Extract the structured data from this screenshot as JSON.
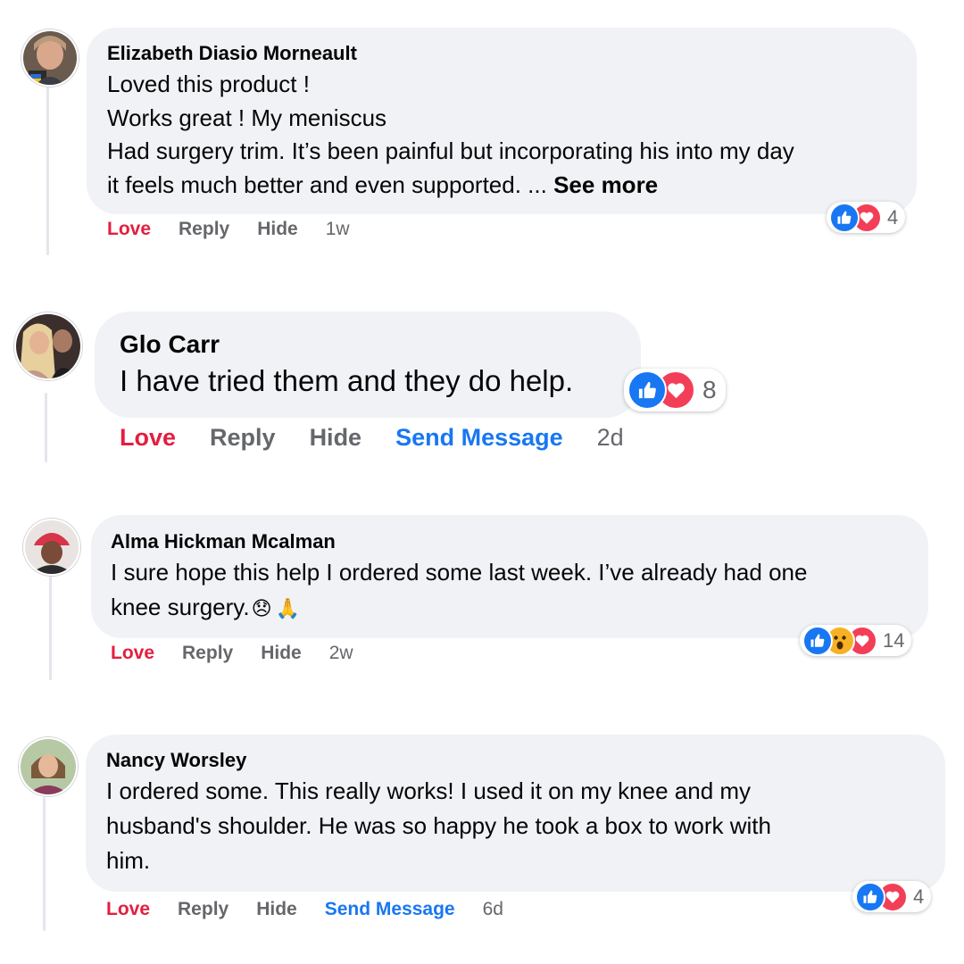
{
  "colors": {
    "bubble": "#f0f2f5",
    "love_action": "#e41e3f",
    "send_message_action": "#1877f2",
    "secondary_text": "#65676b",
    "like_reaction": "#1877f2",
    "love_reaction": "#f33e58",
    "wow_reaction": "#f7b125"
  },
  "actions": {
    "love": "Love",
    "reply": "Reply",
    "hide": "Hide",
    "send_message": "Send Message"
  },
  "comments": [
    {
      "author": "Elizabeth Diasio Morneault",
      "lines": [
        "Loved this product !",
        "Works great ! My meniscus",
        "Had surgery trim. It’s been painful but incorporating his into my day",
        "it feels much better and even supported. ... "
      ],
      "see_more": "See more",
      "reactions": [
        "like-icon",
        "love-icon"
      ],
      "reaction_count": "4",
      "timestamp": "1w",
      "avatar": "avatar-photo"
    },
    {
      "author": "Glo Carr",
      "lines": [
        "I have tried them and they do help."
      ],
      "reactions": [
        "like-icon",
        "love-icon"
      ],
      "reaction_count": "8",
      "timestamp": "2d",
      "avatar": "avatar-photo"
    },
    {
      "author": "Alma Hickman Mcalman",
      "lines": [
        "I sure hope this help I ordered some last week. I’ve already had one",
        "knee surgery."
      ],
      "emojis": [
        "😞",
        "🙏"
      ],
      "reactions": [
        "like-icon",
        "wow-icon",
        "love-icon"
      ],
      "reaction_count": "14",
      "timestamp": "2w",
      "avatar": "avatar-photo"
    },
    {
      "author": "Nancy Worsley",
      "lines": [
        "I ordered some. This really works! I used it on my knee and my",
        "husband's shoulder. He was so happy he took a box to work with",
        "him."
      ],
      "reactions": [
        "like-icon",
        "love-icon"
      ],
      "reaction_count": "4",
      "timestamp": "6d",
      "avatar": "avatar-photo"
    }
  ]
}
